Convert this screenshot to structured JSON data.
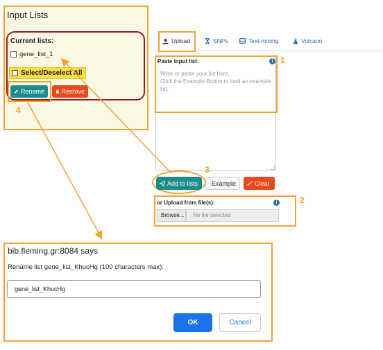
{
  "input_lists": {
    "title": "Input Lists",
    "current_lists_label": "Current lists:",
    "list_items": [
      "gene_list_1"
    ],
    "select_all_label": "Select/Deselect All",
    "rename_label": "Rename",
    "remove_label": "Remove"
  },
  "tabs": [
    {
      "label": "Upload",
      "icon": "upload-icon"
    },
    {
      "label": "SNPs",
      "icon": "hourglass-icon"
    },
    {
      "label": "Text-mining",
      "icon": "inbox-icon"
    },
    {
      "label": "Volcano",
      "icon": "volcano-icon"
    }
  ],
  "paste": {
    "label": "Paste input list:",
    "placeholder": "Write or paste your list here.\nClick the Example Button to load an example list."
  },
  "actions": {
    "add_label": "Add to lists",
    "example_label": "Example",
    "clear_label": "Clear"
  },
  "upload": {
    "label": "or Upload from file(s):",
    "browse_label": "Browse...",
    "file_status": "No file selected"
  },
  "callouts": {
    "n1": "1",
    "n2": "2",
    "n3": "3",
    "n4": "4"
  },
  "dialog": {
    "host": "bib.fleming.gr:8084 says",
    "message": "Rename list gene_list_KhucHg (100 characters max):",
    "input_value": "gene_list_KhucHg",
    "ok_label": "OK",
    "cancel_label": "Cancel"
  },
  "colors": {
    "accent": "#f4a233",
    "teal": "#1f8c8c",
    "danger": "#e8491d",
    "info": "#2a6fb0",
    "ok_blue": "#1a73e8"
  }
}
